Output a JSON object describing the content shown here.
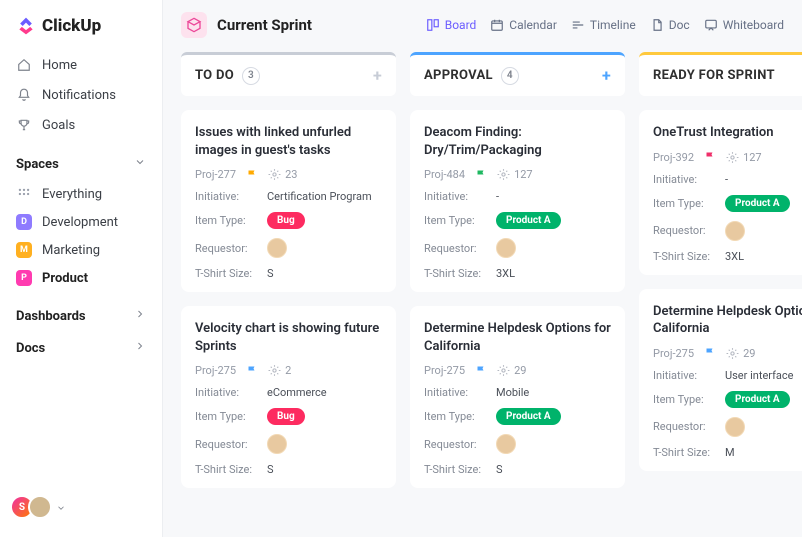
{
  "brand": "ClickUp",
  "nav": {
    "home": "Home",
    "notifications": "Notifications",
    "goals": "Goals"
  },
  "spaces": {
    "header": "Spaces",
    "everything": "Everything",
    "items": [
      {
        "label": "Development",
        "initial": "D",
        "bg": "#8f7bff"
      },
      {
        "label": "Marketing",
        "initial": "M",
        "bg": "#ffb020"
      },
      {
        "label": "Product",
        "initial": "P",
        "bg": "#ff3bb0"
      }
    ]
  },
  "dashboards": "Dashboards",
  "docs": "Docs",
  "user_initial": "S",
  "workspace": "Current Sprint",
  "views": {
    "board": "Board",
    "calendar": "Calendar",
    "timeline": "Timeline",
    "doc": "Doc",
    "whiteboard": "Whiteboard"
  },
  "columns": [
    {
      "title": "TO DO",
      "count": "3",
      "bar": "bar-grey",
      "add_class": "",
      "cards": [
        {
          "title": "Issues with linked unfurled images in guest's tasks",
          "proj": "Proj-277",
          "flag": "#ffaa00",
          "metric": "23",
          "initiative": "Certification Program",
          "type_class": "bug",
          "type_label": "Bug",
          "tshirt": "S"
        },
        {
          "title": "Velocity chart is showing future Sprints",
          "proj": "Proj-275",
          "flag": "#4da4ff",
          "metric": "2",
          "initiative": "eCommerce",
          "type_class": "bug",
          "type_label": "Bug",
          "tshirt": "S"
        }
      ]
    },
    {
      "title": "APPROVAL",
      "count": "4",
      "bar": "bar-blue",
      "add_class": "add-blue",
      "cards": [
        {
          "title": "Deacom Finding: Dry/Trim/Packaging",
          "proj": "Proj-484",
          "flag": "#1fb861",
          "metric": "127",
          "initiative": "-",
          "type_class": "prod",
          "type_label": "Product A",
          "tshirt": "3XL"
        },
        {
          "title": "Determine Helpdesk Options for California",
          "proj": "Proj-275",
          "flag": "#4da4ff",
          "metric": "29",
          "initiative": "Mobile",
          "type_class": "prod",
          "type_label": "Product A",
          "tshirt": "S"
        }
      ]
    },
    {
      "title": "READY FOR SPRINT",
      "count": "",
      "bar": "bar-yellow",
      "add_class": "",
      "cards": [
        {
          "title": "OneTrust Integration",
          "proj": "Proj-392",
          "flag": "#ef2f6a",
          "metric": "127",
          "initiative": "-",
          "type_class": "prod",
          "type_label": "Product A",
          "tshirt": "3XL"
        },
        {
          "title": "Determine Helpdesk Options for California",
          "proj": "Proj-275",
          "flag": "#4da4ff",
          "metric": "29",
          "initiative": "User interface",
          "type_class": "prod",
          "type_label": "Product A",
          "tshirt": "M"
        }
      ]
    }
  ],
  "labels": {
    "initiative": "Initiative:",
    "item_type": "Item Type:",
    "requestor": "Requestor:",
    "tshirt": "T-Shirt Size:"
  }
}
